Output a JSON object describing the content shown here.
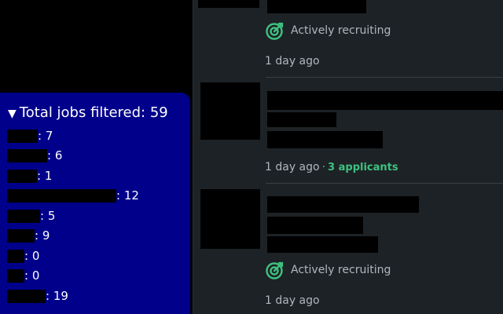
{
  "colors": {
    "panel_bg": "#00008b",
    "feed_bg": "#1d2226",
    "recruiting_green": "#3ec27f",
    "meta_text": "#b0b7bd"
  },
  "filter_panel": {
    "toggle_glyph": "▼",
    "title": "Total jobs filtered: 59",
    "rows": [
      {
        "count": ": 7"
      },
      {
        "count": ": 6"
      },
      {
        "count": ": 1"
      },
      {
        "count": ": 12"
      },
      {
        "count": ": 5"
      },
      {
        "count": ": 9"
      },
      {
        "count": ": 0"
      },
      {
        "count": ": 0"
      },
      {
        "count": ": 19"
      }
    ]
  },
  "jobs": [
    {
      "status_icon": "target-icon",
      "status": "Actively recruiting",
      "posted": "1 day ago"
    },
    {
      "posted": "1 day ago",
      "separator": "·",
      "applicants": "3 applicants"
    },
    {
      "status_icon": "target-icon",
      "status": "Actively recruiting",
      "posted": "1 day ago"
    }
  ]
}
